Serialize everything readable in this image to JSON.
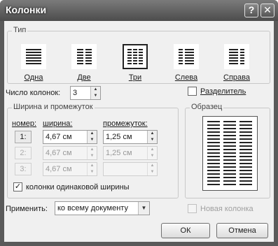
{
  "window": {
    "title": "Колонки",
    "help_glyph": "?",
    "close_glyph": "✕"
  },
  "type_group": {
    "legend": "Тип",
    "presets": [
      {
        "label": "Одна",
        "columns": 1,
        "selected": false
      },
      {
        "label": "Две",
        "columns": 2,
        "selected": false
      },
      {
        "label": "Три",
        "columns": 3,
        "selected": true
      },
      {
        "label": "Слева",
        "columns": 2,
        "selected": false
      },
      {
        "label": "Справа",
        "columns": 2,
        "selected": false
      }
    ]
  },
  "num_columns": {
    "label": "Число колонок:",
    "value": "3"
  },
  "separator": {
    "label": "Разделитель",
    "checked": false
  },
  "width_group": {
    "legend": "Ширина и промежуток",
    "headers": {
      "number": "номер:",
      "width": "ширина:",
      "spacing": "промежуток:"
    },
    "rows": [
      {
        "num": "1:",
        "width": "4,67 см",
        "spacing": "1,25 см",
        "enabled": true
      },
      {
        "num": "2:",
        "width": "4,67 см",
        "spacing": "1,25 см",
        "enabled": false
      },
      {
        "num": "3:",
        "width": "4,67 см",
        "spacing": "",
        "enabled": false
      }
    ],
    "equal_width": {
      "label": "колонки одинаковой ширины",
      "checked": true
    }
  },
  "preview": {
    "legend": "Образец"
  },
  "apply": {
    "label": "Применить:",
    "value": "ко всему документу"
  },
  "new_column": {
    "label": "Новая колонка",
    "checked": false,
    "enabled": false
  },
  "buttons": {
    "ok": "ОК",
    "cancel": "Отмена"
  },
  "icons": {
    "check": "✓",
    "up": "▲",
    "down": "▼"
  }
}
